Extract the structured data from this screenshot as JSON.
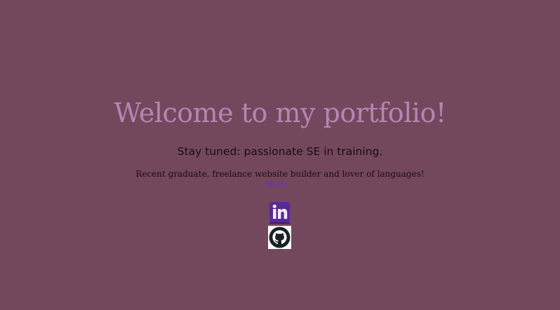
{
  "hero": {
    "title": "Welcome to my portfolio!",
    "tagline": "Stay tuned: passionate SE in training.",
    "intro": "Recent graduate, freelance website builder and lover of languages!",
    "more_link": "More..."
  },
  "social_links": [
    {
      "icon": "linkedin-icon"
    },
    {
      "icon": "github-icon"
    }
  ],
  "colors": {
    "background": "#74485c",
    "title": "#b884b4",
    "link": "#6a2fc8",
    "linkedin": "#5a2a94"
  }
}
